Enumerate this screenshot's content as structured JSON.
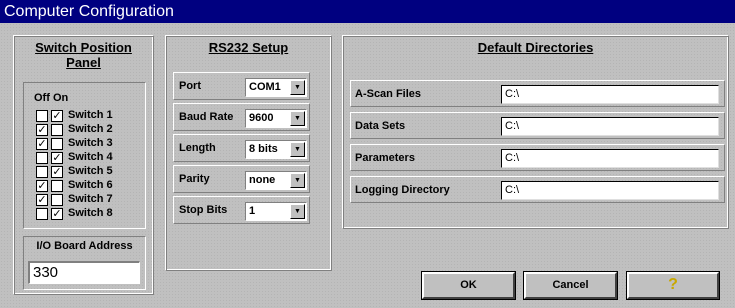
{
  "window": {
    "title": "Computer Configuration"
  },
  "switch_panel": {
    "title_line1": "Switch Position",
    "title_line2": "Panel",
    "header": "Off On",
    "switches": [
      {
        "label": "Switch 1",
        "off": "",
        "on": "✓"
      },
      {
        "label": "Switch 2",
        "off": "✓",
        "on": ""
      },
      {
        "label": "Switch 3",
        "off": "✓",
        "on": ""
      },
      {
        "label": "Switch 4",
        "off": "",
        "on": "✓"
      },
      {
        "label": "Switch 5",
        "off": "",
        "on": "✓"
      },
      {
        "label": "Switch 6",
        "off": "✓",
        "on": ""
      },
      {
        "label": "Switch 7",
        "off": "✓",
        "on": ""
      },
      {
        "label": "Switch 8",
        "off": "",
        "on": "✓"
      }
    ],
    "io_label": "I/O Board Address",
    "io_value": "330"
  },
  "rs232": {
    "title": "RS232 Setup",
    "fields": [
      {
        "label": "Port",
        "value": "COM1"
      },
      {
        "label": "Baud Rate",
        "value": "9600"
      },
      {
        "label": "Length",
        "value": "8 bits"
      },
      {
        "label": "Parity",
        "value": "none"
      },
      {
        "label": "Stop Bits",
        "value": "1"
      }
    ]
  },
  "directories": {
    "title": "Default Directories",
    "fields": [
      {
        "label": "A-Scan Files",
        "value": "C:\\"
      },
      {
        "label": "Data Sets",
        "value": "C:\\"
      },
      {
        "label": "Parameters",
        "value": "C:\\"
      },
      {
        "label": "Logging Directory",
        "value": "C:\\"
      }
    ]
  },
  "buttons": {
    "ok": "OK",
    "cancel": "Cancel",
    "help_icon": "help-question-icon"
  },
  "colors": {
    "titlebar": "#000080",
    "face": "#c0c0c0",
    "help_glyph": "#c8a800"
  }
}
